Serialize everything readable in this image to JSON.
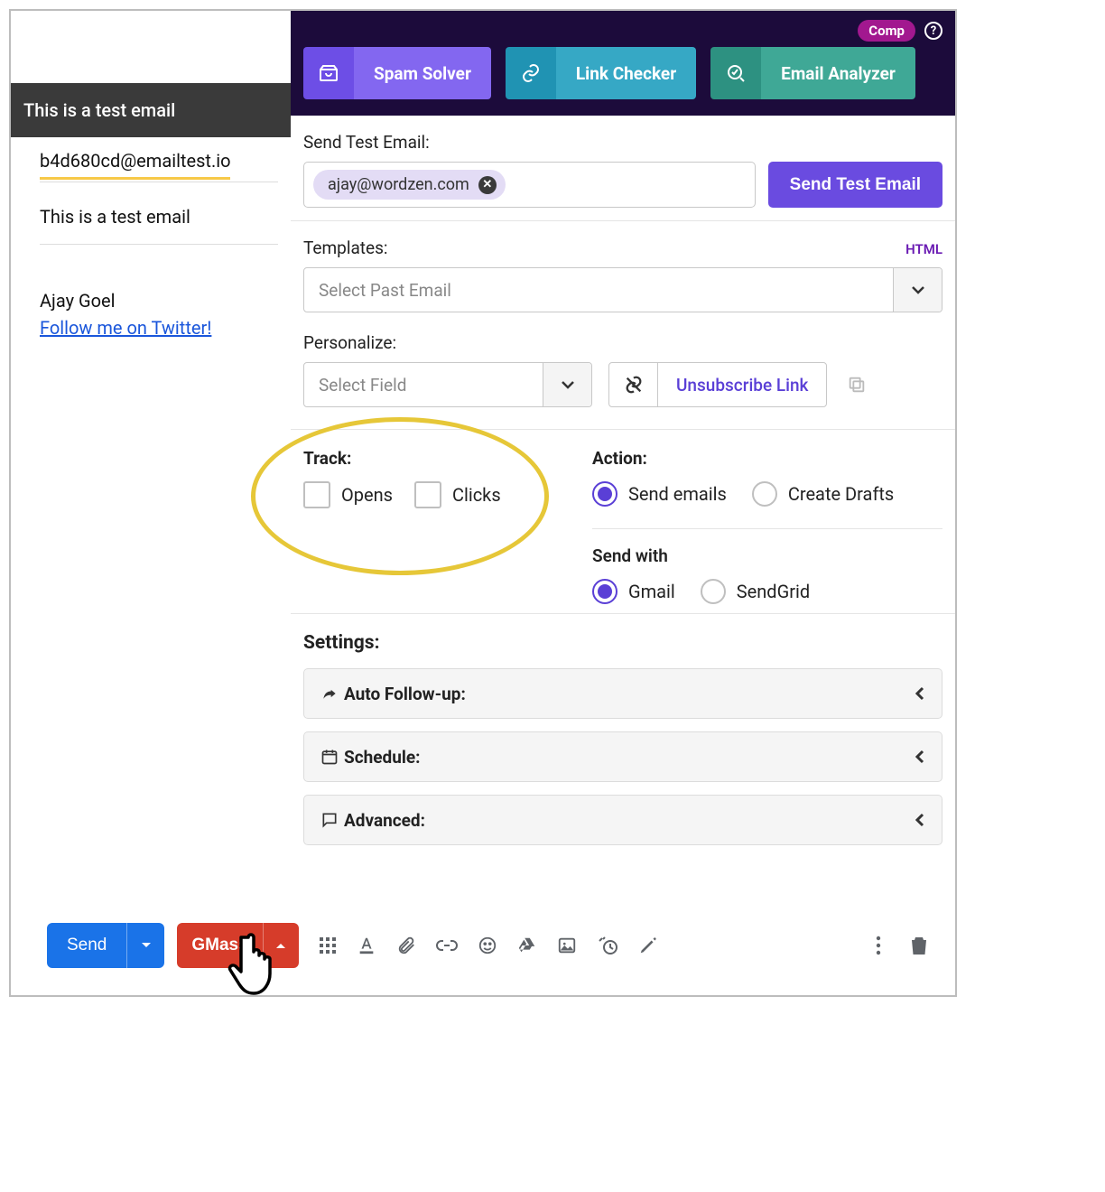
{
  "left": {
    "subject_header": "This is a test email",
    "to_address": "b4d680cd@emailtest.io",
    "body_subject": "This is a test email",
    "signature_name": "Ajay Goel",
    "signature_link": "Follow me on Twitter!"
  },
  "header": {
    "comp_label": "Comp",
    "tools": {
      "spam": "Spam Solver",
      "link": "Link Checker",
      "analyzer": "Email Analyzer"
    }
  },
  "test": {
    "label": "Send Test Email:",
    "chip": "ajay@wordzen.com",
    "button": "Send Test Email"
  },
  "templates": {
    "label": "Templates:",
    "html_link": "HTML",
    "placeholder": "Select Past Email"
  },
  "personalize": {
    "label": "Personalize:",
    "placeholder": "Select Field",
    "unsubscribe": "Unsubscribe Link"
  },
  "track": {
    "label": "Track:",
    "opens": "Opens",
    "clicks": "Clicks"
  },
  "action": {
    "label": "Action:",
    "send_emails": "Send emails",
    "create_drafts": "Create Drafts",
    "send_with_label": "Send with",
    "gmail": "Gmail",
    "sendgrid": "SendGrid"
  },
  "settings": {
    "label": "Settings:",
    "followup": "Auto Follow-up:",
    "schedule": "Schedule:",
    "advanced": "Advanced:"
  },
  "bottom": {
    "send": "Send",
    "gmass": "GMass"
  }
}
